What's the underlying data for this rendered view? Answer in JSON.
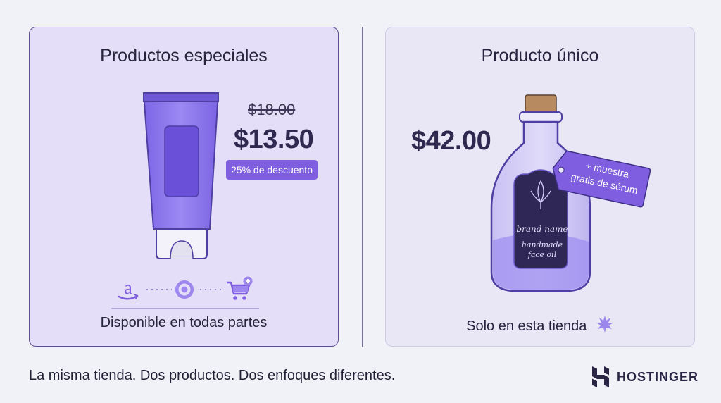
{
  "left_card": {
    "title": "Productos especiales",
    "old_price": "$18.00",
    "price": "$13.50",
    "discount": "25% de descuento",
    "channels": [
      "amazon-icon",
      "target-icon",
      "shopping-cart-add-icon"
    ],
    "bottom_label": "Disponible en todas partes"
  },
  "right_card": {
    "title": "Producto único",
    "price": "$42.00",
    "tag_line1": "+ muestra",
    "tag_line2": "gratis de sérum",
    "label_line1": "brand name",
    "label_line2": "handmade",
    "label_line3": "face oil",
    "bottom_label": "Solo en esta tienda"
  },
  "footer": {
    "tagline": "La misma tienda. Dos productos. Dos enfoques diferentes.",
    "brand": "HOSTINGER"
  },
  "colors": {
    "accent": "#7f5fe0",
    "dark": "#2f2950",
    "card_left_bg": "#e4def8",
    "card_right_bg": "#e9e7f6"
  }
}
